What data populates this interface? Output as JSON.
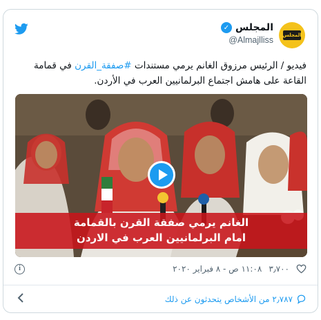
{
  "author": {
    "display_name": "المجلس",
    "handle": "@Almajlliss",
    "avatar_label": "المجلس",
    "verified_mark": "✓"
  },
  "tweet": {
    "text_prefix": "فيديو / الرئيس مرزوق الغانم يرمي مستندات ",
    "hashtag": "#صفقة_القرن",
    "text_suffix": " في قمامة القاعة على هامش اجتماع البرلمانيين العرب في الأردن."
  },
  "media": {
    "caption_line1": "الغانم يرمي صفقة القرن بالقمامة",
    "caption_line2": "امام البرلمانيين العرب في الاردن"
  },
  "meta": {
    "likes": "٣٫٧٠٠",
    "timestamp": "١١:٠٨ ص - ٨ فبراير ٢٠٢٠",
    "info_glyph": "i"
  },
  "footer": {
    "conversation": "٢٫٧٨٧ من الأشخاص يتحدثون عن ذلك"
  },
  "icons": {
    "brand": "twitter-bird-icon",
    "accent": "#1d9bf0"
  }
}
